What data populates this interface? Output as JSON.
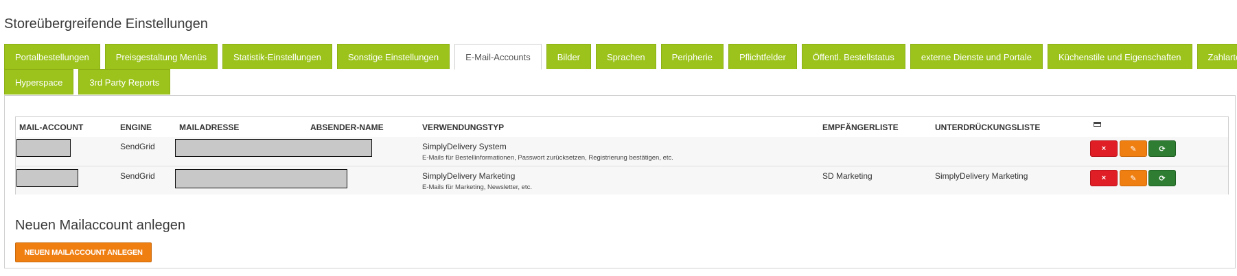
{
  "page": {
    "title": "Storeübergreifende Einstellungen"
  },
  "tabs": {
    "row1": [
      "Portalbestellungen",
      "Preisgestaltung Menüs",
      "Statistik-Einstellungen",
      "Sonstige Einstellungen",
      "E-Mail-Accounts",
      "Bilder",
      "Sprachen",
      "Peripherie",
      "Pflichtfelder",
      "Öffentl. Bestellstatus",
      "externe Dienste und Portale",
      "Küchenstile und Eigenschaften",
      "Zahlarten"
    ],
    "row2": [
      "Hyperspace",
      "3rd Party Reports"
    ],
    "active": "E-Mail-Accounts"
  },
  "table": {
    "headers": {
      "account": "MAIL-ACCOUNT",
      "engine": "ENGINE",
      "address": "MAILADRESSE",
      "sender": "ABSENDER-NAME",
      "usage": "VERWENDUNGSTYP",
      "recipients": "EMPFÄNGERLISTE",
      "suppression": "UNTERDRÜCKUNGSLISTE"
    },
    "rows": [
      {
        "engine": "SendGrid",
        "usage_title": "SimplyDelivery System",
        "usage_desc": "E-Mails für Bestellinformationen, Passwort zurücksetzen, Registrierung bestätigen, etc.",
        "recipients": "",
        "suppression": ""
      },
      {
        "engine": "SendGrid",
        "usage_title": "SimplyDelivery Marketing",
        "usage_desc": "E-Mails für Marketing, Newsletter, etc.",
        "recipients": "SD Marketing",
        "suppression": "SimplyDelivery Marketing"
      }
    ],
    "actions": {
      "delete": "×",
      "edit": "✎",
      "sync": "⟳"
    }
  },
  "create": {
    "title": "Neuen Mailaccount anlegen",
    "button": "NEUEN MAILACCOUNT ANLEGEN"
  },
  "colors": {
    "tab_green": "#9bc31c",
    "delete_red": "#e01e26",
    "edit_orange": "#f07f12",
    "sync_green": "#2e7d32"
  }
}
